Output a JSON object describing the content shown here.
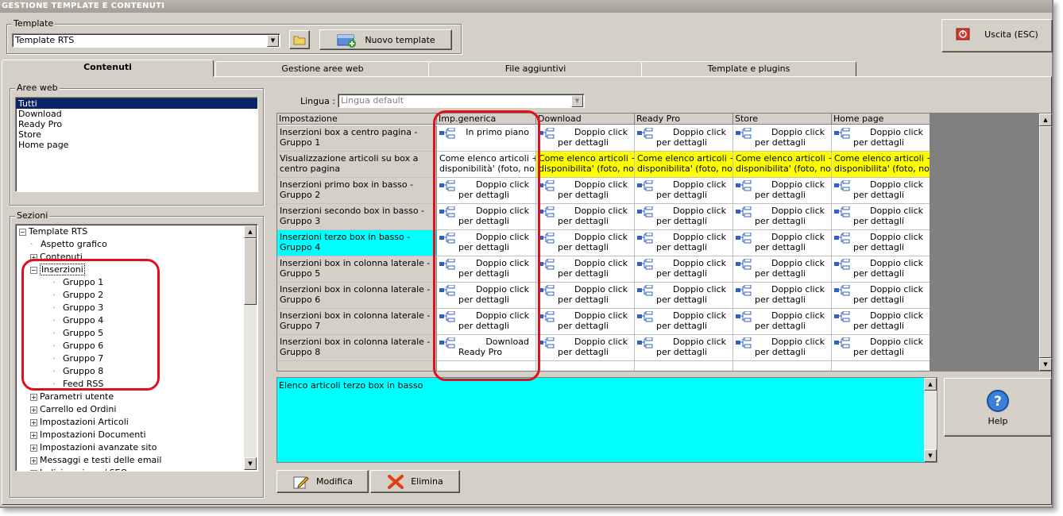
{
  "window": {
    "title": "GESTIONE TEMPLATE E CONTENUTI"
  },
  "template_group": {
    "label": "Template",
    "selected": "Template RTS",
    "new_button": "Nuovo template"
  },
  "exit_button": "Uscita (ESC)",
  "help_button": "Help",
  "tabs": [
    "Contenuti",
    "Gestione aree web",
    "File aggiuntivi",
    "Template e plugins"
  ],
  "aree_web": {
    "label": "Aree web",
    "items": [
      "Tutti",
      "Download",
      "Ready Pro",
      "Store",
      "Home page"
    ],
    "selected_index": 0
  },
  "sezioni": {
    "label": "Sezioni",
    "tree": [
      {
        "text": "Template RTS",
        "level": 0,
        "expander": "minus"
      },
      {
        "text": "Aspetto grafico",
        "level": 1,
        "expander": "none"
      },
      {
        "text": "Contenuti",
        "level": 1,
        "expander": "plus"
      },
      {
        "text": "Inserzioni",
        "level": 1,
        "expander": "minus",
        "selected": true
      },
      {
        "text": "Gruppo 1",
        "level": 2,
        "expander": "none"
      },
      {
        "text": "Gruppo 2",
        "level": 2,
        "expander": "none"
      },
      {
        "text": "Gruppo 3",
        "level": 2,
        "expander": "none"
      },
      {
        "text": "Gruppo 4",
        "level": 2,
        "expander": "none"
      },
      {
        "text": "Gruppo 5",
        "level": 2,
        "expander": "none"
      },
      {
        "text": "Gruppo 6",
        "level": 2,
        "expander": "none"
      },
      {
        "text": "Gruppo 7",
        "level": 2,
        "expander": "none"
      },
      {
        "text": "Gruppo 8",
        "level": 2,
        "expander": "none"
      },
      {
        "text": "Feed RSS",
        "level": 2,
        "expander": "none"
      },
      {
        "text": "Parametri utente",
        "level": 1,
        "expander": "plus"
      },
      {
        "text": "Carrello ed Ordini",
        "level": 1,
        "expander": "plus"
      },
      {
        "text": "Impostazioni Articoli",
        "level": 1,
        "expander": "plus"
      },
      {
        "text": "Impostazioni Documenti",
        "level": 1,
        "expander": "plus"
      },
      {
        "text": "Impostazioni avanzate sito",
        "level": 1,
        "expander": "plus"
      },
      {
        "text": "Messaggi e testi delle email",
        "level": 1,
        "expander": "plus"
      },
      {
        "text": "Indicizzazione / SEO",
        "level": 1,
        "expander": "plus"
      }
    ]
  },
  "lingua": {
    "label": "Lingua :",
    "selected": "Lingua default"
  },
  "grid": {
    "columns": [
      "Impostazione",
      "Imp.generica",
      "Download",
      "Ready Pro",
      "Store",
      "Home page"
    ],
    "rows": [
      {
        "name": "Inserzioni box a centro pagina - Gruppo 1",
        "generic": [
          "In primo piano",
          ""
        ],
        "others": [
          "Doppio click",
          "per dettagli"
        ],
        "type": "icon"
      },
      {
        "name": "Visualizzazione articoli su box a centro pagina",
        "generic": [
          "Come elenco articoli +",
          "disponibilità' (foto, nom..."
        ],
        "others": [
          "Come elenco articoli +",
          "disponibilita' (foto, nom..."
        ],
        "type": "text"
      },
      {
        "name": "Inserzioni primo box in basso - Gruppo 2",
        "generic": [
          "Doppio click",
          "per dettagli"
        ],
        "others": [
          "Doppio click",
          "per dettagli"
        ],
        "type": "icon"
      },
      {
        "name": "Inserzioni secondo box in basso - Gruppo 3",
        "generic": [
          "Doppio click",
          "per dettagli"
        ],
        "others": [
          "Doppio click",
          "per dettagli"
        ],
        "type": "icon"
      },
      {
        "name": "Inserzioni terzo box in basso - Gruppo 4",
        "generic": [
          "Doppio click",
          "per dettagli"
        ],
        "others": [
          "Doppio click",
          "per dettagli"
        ],
        "type": "icon",
        "highlight": true
      },
      {
        "name": "Inserzioni box in colonna laterale - Gruppo 5",
        "generic": [
          "Doppio click",
          "per dettagli"
        ],
        "others": [
          "Doppio click",
          "per dettagli"
        ],
        "type": "icon"
      },
      {
        "name": "Inserzioni box in colonna laterale - Gruppo 6",
        "generic": [
          "Doppio click",
          "per dettagli"
        ],
        "others": [
          "Doppio click",
          "per dettagli"
        ],
        "type": "icon"
      },
      {
        "name": "Inserzioni box in colonna laterale - Gruppo 7",
        "generic": [
          "Doppio click",
          "per dettagli"
        ],
        "others": [
          "Doppio click",
          "per dettagli"
        ],
        "type": "icon"
      },
      {
        "name": "Inserzioni box in colonna laterale - Gruppo 8",
        "generic": [
          "Download",
          "Ready Pro"
        ],
        "others": [
          "Doppio click",
          "per dettagli"
        ],
        "type": "icon"
      }
    ]
  },
  "memo": {
    "text": "Elenco articoli terzo box in basso"
  },
  "bottom_buttons": {
    "edit": "Modifica",
    "delete": "Elimina"
  },
  "colors": {
    "selection": "#0a246a",
    "highlight_cyan": "#00ffff",
    "yellow": "#ffff00",
    "annotation_red": "#e0101c"
  }
}
